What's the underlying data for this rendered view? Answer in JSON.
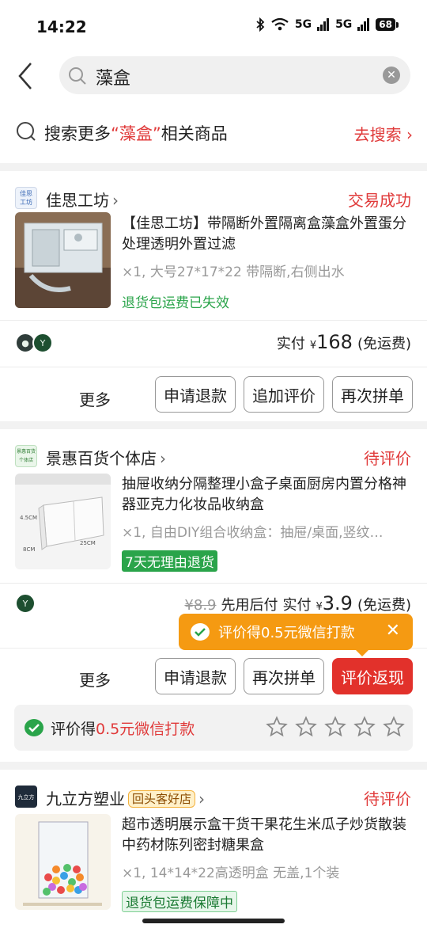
{
  "status_bar": {
    "time": "14:22",
    "network1": "5G",
    "network2": "5G",
    "battery": "68"
  },
  "header": {
    "search_query": "藻盒"
  },
  "search_more": {
    "prefix": "搜索更多",
    "keyword": "“藻盒”",
    "suffix": "相关商品",
    "action": "去搜索"
  },
  "orders": [
    {
      "shop_logo_text": "佳思工坊",
      "shop_name": "佳思工坊",
      "status": "交易成功",
      "title": "【佳思工坊】带隔断外置隔离盒藻盒外置蛋分处理透明外置过滤",
      "spec": "×1,  大号27*17*22 带隔断,右侧出水",
      "note": "退货包运费已失效",
      "price_label": "实付",
      "currency": "¥",
      "price": "168",
      "shipping": "(免运费)",
      "more": "更多",
      "buttons": [
        "申请退款",
        "追加评价",
        "再次拼单"
      ]
    },
    {
      "shop_logo_text": "景惠百货个体店",
      "shop_name": "景惠百货个体店",
      "status": "待评价",
      "title": "抽屉收纳分隔整理小盒子桌面厨房内置分格神器亚克力化妆品收纳盒",
      "spec": "×1,  自由DIY组合收纳盒：抽屉/桌面,竖纹…",
      "tag": "7天无理由退货",
      "original_price": "¥8.9",
      "pay_later": "先用后付",
      "price_label": "实付",
      "currency": "¥",
      "price": "3.9",
      "shipping": "(免运费)",
      "tooltip": "评价得0.5元微信打款",
      "more": "更多",
      "buttons": [
        "申请退款",
        "再次拼单",
        "评价返现"
      ],
      "review_prefix": "评价得",
      "review_amount": "0.5元微信打款"
    },
    {
      "shop_logo_text": "九立方",
      "shop_name": "九立方塑业",
      "shop_badge": "回头客好店",
      "status": "待评价",
      "title": "超市透明展示盒干货干果花生米瓜子炒货散装中药材陈列密封糖果盒",
      "spec": "×1,  14*14*22高透明盒 无盖,1个装",
      "tag": "退货包运费保障中"
    }
  ],
  "colors": {
    "accent_red": "#e03a3a",
    "green": "#2aa44a",
    "orange": "#f59a12"
  },
  "rating": {
    "stars": 0,
    "max": 5
  }
}
